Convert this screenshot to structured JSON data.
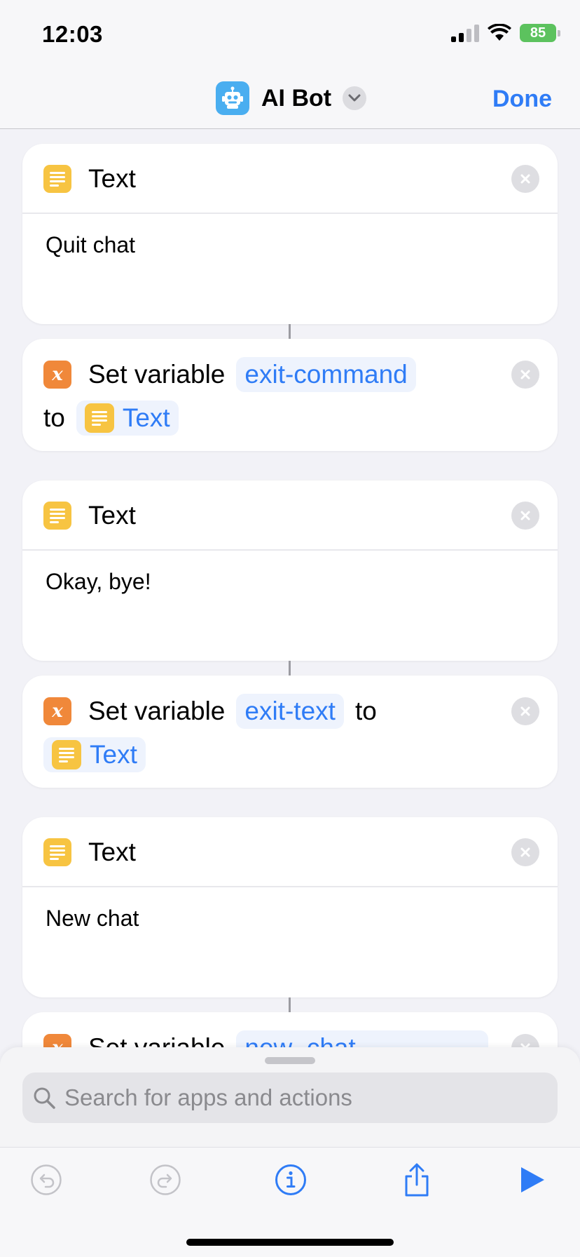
{
  "status_bar": {
    "time": "12:03",
    "battery": "85"
  },
  "header": {
    "title": "AI Bot",
    "done_label": "Done"
  },
  "actions": [
    {
      "type": "text",
      "title": "Text",
      "content": "Quit chat"
    },
    {
      "type": "set_variable",
      "label": "Set variable",
      "variable": "exit-command",
      "to_label": "to",
      "value_label": "Text"
    },
    {
      "type": "text",
      "title": "Text",
      "content": "Okay, bye!"
    },
    {
      "type": "set_variable",
      "label": "Set variable",
      "variable": "exit-text",
      "to_label": "to",
      "value_label": "Text"
    },
    {
      "type": "text",
      "title": "Text",
      "content": "New chat"
    },
    {
      "type": "set_variable",
      "label": "Set variable",
      "variable": "new_chat"
    }
  ],
  "search": {
    "placeholder": "Search for apps and actions"
  },
  "colors": {
    "accent": "#2f7cf6",
    "text_action": "#f7c442",
    "variable_action": "#f0883a",
    "app_icon": "#4aaef0"
  },
  "icons": {
    "status": [
      "signal-icon",
      "wifi-icon",
      "battery-icon"
    ],
    "toolbar": [
      "undo-icon",
      "redo-icon",
      "info-icon",
      "share-icon",
      "play-icon"
    ]
  }
}
